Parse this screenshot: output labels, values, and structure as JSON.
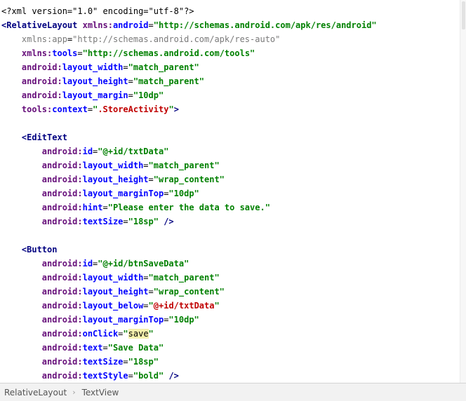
{
  "editor": {
    "language": "xml",
    "highlighted_value": "save",
    "lines": [
      [
        [
          "decl",
          "<?xml version=\"1.0\" encoding=\"utf-8\"?>"
        ]
      ],
      [
        [
          "tag",
          "<RelativeLayout "
        ],
        [
          "ns",
          "xmlns:"
        ],
        [
          "attr",
          "android"
        ],
        [
          "plain",
          "="
        ],
        [
          "val",
          "\"http://schemas.android.com/apk/res/android\""
        ]
      ],
      [
        [
          "plain",
          "    "
        ],
        [
          "attr-g",
          "xmlns:app"
        ],
        [
          "plain",
          "="
        ],
        [
          "val-g",
          "\"http://schemas.android.com/apk/res-auto\""
        ]
      ],
      [
        [
          "plain",
          "    "
        ],
        [
          "ns",
          "xmlns:"
        ],
        [
          "attr",
          "tools"
        ],
        [
          "plain",
          "="
        ],
        [
          "val",
          "\"http://schemas.android.com/tools\""
        ]
      ],
      [
        [
          "plain",
          "    "
        ],
        [
          "ns",
          "android:"
        ],
        [
          "attr",
          "layout_width"
        ],
        [
          "plain",
          "="
        ],
        [
          "val",
          "\"match_parent\""
        ]
      ],
      [
        [
          "plain",
          "    "
        ],
        [
          "ns",
          "android:"
        ],
        [
          "attr",
          "layout_height"
        ],
        [
          "plain",
          "="
        ],
        [
          "val",
          "\"match_parent\""
        ]
      ],
      [
        [
          "plain",
          "    "
        ],
        [
          "ns",
          "android:"
        ],
        [
          "attr",
          "layout_margin"
        ],
        [
          "plain",
          "="
        ],
        [
          "val",
          "\"10dp\""
        ]
      ],
      [
        [
          "plain",
          "    "
        ],
        [
          "ns",
          "tools:"
        ],
        [
          "attr",
          "context"
        ],
        [
          "plain",
          "="
        ],
        [
          "val",
          "\""
        ],
        [
          "ref",
          ".StoreActivity"
        ],
        [
          "val",
          "\""
        ],
        [
          "tag",
          ">"
        ]
      ],
      [
        [
          "plain",
          ""
        ]
      ],
      [
        [
          "plain",
          "    "
        ],
        [
          "tag",
          "<EditText"
        ]
      ],
      [
        [
          "plain",
          "        "
        ],
        [
          "ns",
          "android:"
        ],
        [
          "attr",
          "id"
        ],
        [
          "plain",
          "="
        ],
        [
          "val",
          "\"@+id/txtData\""
        ]
      ],
      [
        [
          "plain",
          "        "
        ],
        [
          "ns",
          "android:"
        ],
        [
          "attr",
          "layout_width"
        ],
        [
          "plain",
          "="
        ],
        [
          "val",
          "\"match_parent\""
        ]
      ],
      [
        [
          "plain",
          "        "
        ],
        [
          "ns",
          "android:"
        ],
        [
          "attr",
          "layout_height"
        ],
        [
          "plain",
          "="
        ],
        [
          "val",
          "\"wrap_content\""
        ]
      ],
      [
        [
          "plain",
          "        "
        ],
        [
          "ns",
          "android:"
        ],
        [
          "attr",
          "layout_marginTop"
        ],
        [
          "plain",
          "="
        ],
        [
          "val",
          "\"10dp\""
        ]
      ],
      [
        [
          "plain",
          "        "
        ],
        [
          "ns",
          "android:"
        ],
        [
          "attr",
          "hint"
        ],
        [
          "plain",
          "="
        ],
        [
          "val",
          "\"Please enter the data to save.\""
        ]
      ],
      [
        [
          "plain",
          "        "
        ],
        [
          "ns",
          "android:"
        ],
        [
          "attr",
          "textSize"
        ],
        [
          "plain",
          "="
        ],
        [
          "val",
          "\"18sp\""
        ],
        [
          "tag",
          " />"
        ]
      ],
      [
        [
          "plain",
          ""
        ]
      ],
      [
        [
          "plain",
          "    "
        ],
        [
          "tag",
          "<Button"
        ]
      ],
      [
        [
          "plain",
          "        "
        ],
        [
          "ns",
          "android:"
        ],
        [
          "attr",
          "id"
        ],
        [
          "plain",
          "="
        ],
        [
          "val",
          "\"@+id/btnSaveData\""
        ]
      ],
      [
        [
          "plain",
          "        "
        ],
        [
          "ns",
          "android:"
        ],
        [
          "attr",
          "layout_width"
        ],
        [
          "plain",
          "="
        ],
        [
          "val",
          "\"match_parent\""
        ]
      ],
      [
        [
          "plain",
          "        "
        ],
        [
          "ns",
          "android:"
        ],
        [
          "attr",
          "layout_height"
        ],
        [
          "plain",
          "="
        ],
        [
          "val",
          "\"wrap_content\""
        ]
      ],
      [
        [
          "plain",
          "        "
        ],
        [
          "ns",
          "android:"
        ],
        [
          "attr",
          "layout_below"
        ],
        [
          "plain",
          "="
        ],
        [
          "val",
          "\""
        ],
        [
          "ref",
          "@+id/txtData"
        ],
        [
          "val",
          "\""
        ]
      ],
      [
        [
          "plain",
          "        "
        ],
        [
          "ns",
          "android:"
        ],
        [
          "attr",
          "layout_marginTop"
        ],
        [
          "plain",
          "="
        ],
        [
          "val",
          "\"10dp\""
        ]
      ],
      [
        [
          "plain",
          "        "
        ],
        [
          "ns",
          "android:"
        ],
        [
          "attr",
          "onClick"
        ],
        [
          "plain",
          "="
        ],
        [
          "val",
          "\""
        ],
        [
          "hl",
          "save"
        ],
        [
          "val",
          "\""
        ]
      ],
      [
        [
          "plain",
          "        "
        ],
        [
          "ns",
          "android:"
        ],
        [
          "attr",
          "text"
        ],
        [
          "plain",
          "="
        ],
        [
          "val",
          "\"Save Data\""
        ]
      ],
      [
        [
          "plain",
          "        "
        ],
        [
          "ns",
          "android:"
        ],
        [
          "attr",
          "textSize"
        ],
        [
          "plain",
          "="
        ],
        [
          "val",
          "\"18sp\""
        ]
      ],
      [
        [
          "plain",
          "        "
        ],
        [
          "ns",
          "android:"
        ],
        [
          "attr",
          "textStyle"
        ],
        [
          "plain",
          "="
        ],
        [
          "val",
          "\"bold\""
        ],
        [
          "tag",
          " />"
        ]
      ]
    ]
  },
  "breadcrumb": {
    "items": [
      "RelativeLayout",
      "TextView"
    ],
    "separator_icon": "chevron-right-icon"
  },
  "colors": {
    "tag": "#000080",
    "namespace": "#660e7a",
    "attribute": "#0000ff",
    "value": "#008000",
    "reference": "#c00000",
    "unused": "#7a7a7a",
    "highlight": "#f5f1ad",
    "breadcrumb_bg": "#f2f2f2"
  }
}
